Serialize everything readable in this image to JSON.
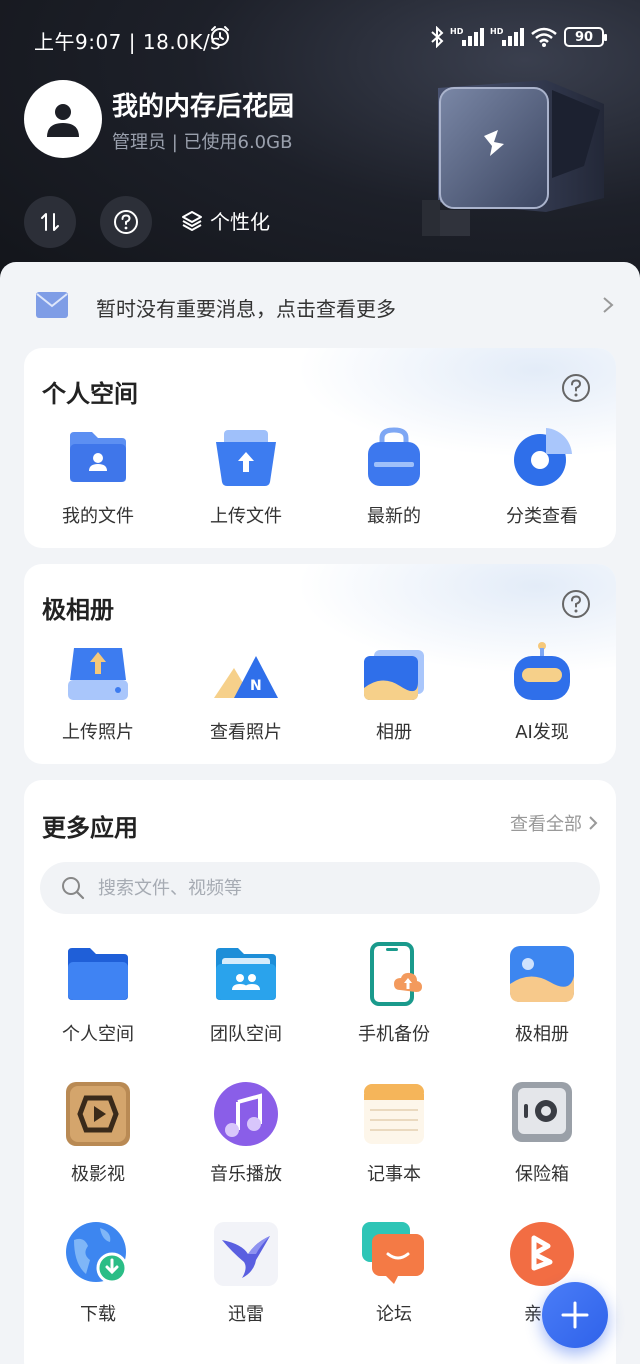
{
  "status_bar": {
    "time": "上午9:07 | 18.0K/s",
    "battery": "90",
    "icons": [
      "alarm-icon",
      "bluetooth-icon",
      "hd-signal-icon",
      "hd-signal-icon",
      "wifi-icon",
      "battery-icon"
    ]
  },
  "header": {
    "user_name": "我的内存后花园",
    "user_sub": "管理员 | 已使用6.0GB",
    "personalize_label": "个性化"
  },
  "notice": {
    "text": "暂时没有重要消息，点击查看更多"
  },
  "personal_space": {
    "title": "个人空间",
    "items": [
      {
        "label": "我的文件",
        "icon": "folder-user-icon"
      },
      {
        "label": "上传文件",
        "icon": "upload-box-icon"
      },
      {
        "label": "最新的",
        "icon": "bag-icon"
      },
      {
        "label": "分类查看",
        "icon": "pie-chart-icon"
      }
    ]
  },
  "photos": {
    "title": "极相册",
    "items": [
      {
        "label": "上传照片",
        "icon": "upload-drive-icon"
      },
      {
        "label": "查看照片",
        "icon": "mountain-icon"
      },
      {
        "label": "相册",
        "icon": "album-icon"
      },
      {
        "label": "AI发现",
        "icon": "robot-icon"
      }
    ]
  },
  "more_apps": {
    "title": "更多应用",
    "see_all": "查看全部",
    "search_placeholder": "搜索文件、视频等",
    "apps": [
      {
        "label": "个人空间",
        "icon": "folder-icon"
      },
      {
        "label": "团队空间",
        "icon": "team-folder-icon"
      },
      {
        "label": "手机备份",
        "icon": "phone-backup-icon"
      },
      {
        "label": "极相册",
        "icon": "photo-icon"
      },
      {
        "label": "极影视",
        "icon": "film-icon"
      },
      {
        "label": "音乐播放",
        "icon": "music-icon"
      },
      {
        "label": "记事本",
        "icon": "notepad-icon"
      },
      {
        "label": "保险箱",
        "icon": "safe-icon"
      },
      {
        "label": "下载",
        "icon": "globe-download-icon"
      },
      {
        "label": "迅雷",
        "icon": "thunder-bird-icon"
      },
      {
        "label": "论坛",
        "icon": "forum-icon"
      },
      {
        "label": "亲情",
        "icon": "family-icon"
      }
    ]
  },
  "colors": {
    "accent": "#2f62ea",
    "header_bg": "#1d2029",
    "page_bg": "#f2f4f7"
  }
}
